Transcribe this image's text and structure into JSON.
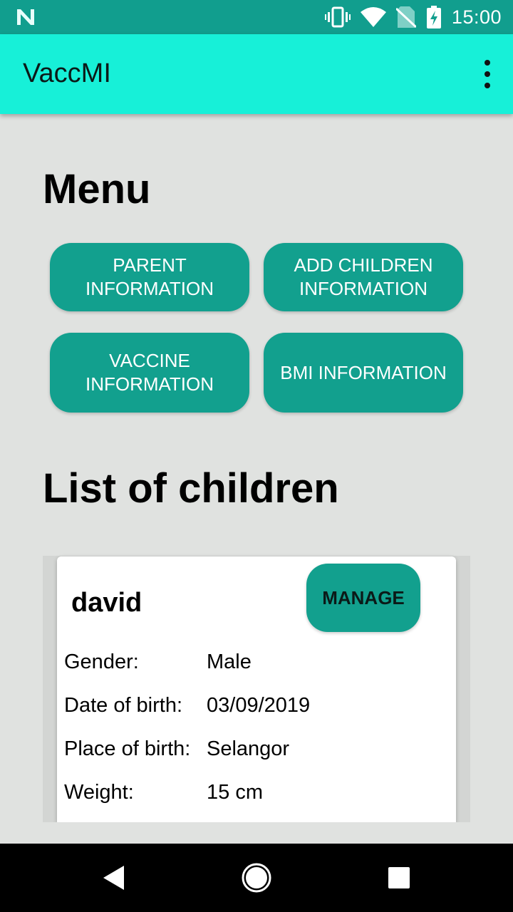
{
  "status_bar": {
    "time": "15:00",
    "icons": [
      "n-logo-icon",
      "vibrate-icon",
      "wifi-icon",
      "no-sim-icon",
      "battery-charging-icon"
    ]
  },
  "app_bar": {
    "title": "VaccMI",
    "menu_icon": "more-vert-icon"
  },
  "menu": {
    "heading": "Menu",
    "buttons": {
      "parent": "PARENT\nINFORMATION",
      "add_children": "ADD CHILDREN\nINFORMATION",
      "vaccine": "VACCINE\nINFORMATION",
      "bmi": "BMI INFORMATION"
    }
  },
  "children": {
    "heading": "List of children",
    "items": [
      {
        "name": "david",
        "manage_label": "MANAGE",
        "fields": [
          {
            "label": "Gender:",
            "value": "Male"
          },
          {
            "label": "Date of birth:",
            "value": "03/09/2019"
          },
          {
            "label": "Place of birth:",
            "value": "Selangor"
          },
          {
            "label": "Weight:",
            "value": "15 cm"
          }
        ]
      }
    ]
  },
  "nav_bar": {
    "icons": [
      "back-icon",
      "home-icon",
      "recents-icon"
    ]
  },
  "colors": {
    "status_bar": "#119e8e",
    "app_bar": "#17f0d8",
    "button": "#12a08e",
    "background": "#e0e2e0"
  }
}
